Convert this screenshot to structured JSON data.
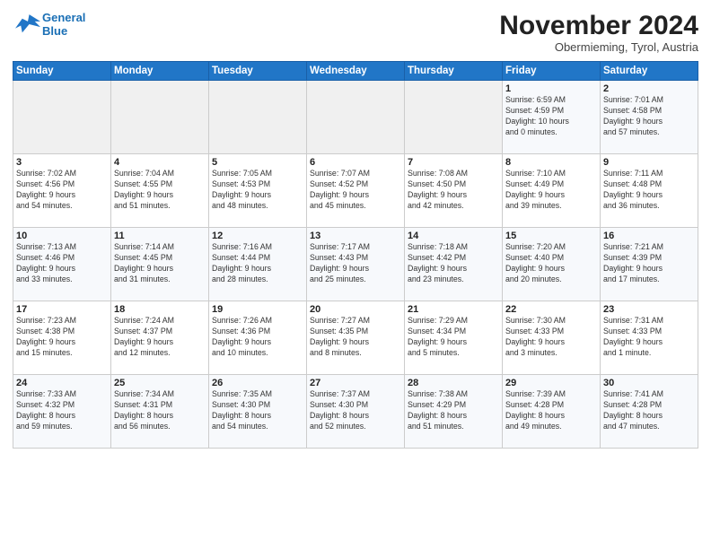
{
  "header": {
    "logo_top": "General",
    "logo_bottom": "Blue",
    "month": "November 2024",
    "location": "Obermieming, Tyrol, Austria"
  },
  "days_of_week": [
    "Sunday",
    "Monday",
    "Tuesday",
    "Wednesday",
    "Thursday",
    "Friday",
    "Saturday"
  ],
  "weeks": [
    [
      {
        "num": "",
        "info": ""
      },
      {
        "num": "",
        "info": ""
      },
      {
        "num": "",
        "info": ""
      },
      {
        "num": "",
        "info": ""
      },
      {
        "num": "",
        "info": ""
      },
      {
        "num": "1",
        "info": "Sunrise: 6:59 AM\nSunset: 4:59 PM\nDaylight: 10 hours\nand 0 minutes."
      },
      {
        "num": "2",
        "info": "Sunrise: 7:01 AM\nSunset: 4:58 PM\nDaylight: 9 hours\nand 57 minutes."
      }
    ],
    [
      {
        "num": "3",
        "info": "Sunrise: 7:02 AM\nSunset: 4:56 PM\nDaylight: 9 hours\nand 54 minutes."
      },
      {
        "num": "4",
        "info": "Sunrise: 7:04 AM\nSunset: 4:55 PM\nDaylight: 9 hours\nand 51 minutes."
      },
      {
        "num": "5",
        "info": "Sunrise: 7:05 AM\nSunset: 4:53 PM\nDaylight: 9 hours\nand 48 minutes."
      },
      {
        "num": "6",
        "info": "Sunrise: 7:07 AM\nSunset: 4:52 PM\nDaylight: 9 hours\nand 45 minutes."
      },
      {
        "num": "7",
        "info": "Sunrise: 7:08 AM\nSunset: 4:50 PM\nDaylight: 9 hours\nand 42 minutes."
      },
      {
        "num": "8",
        "info": "Sunrise: 7:10 AM\nSunset: 4:49 PM\nDaylight: 9 hours\nand 39 minutes."
      },
      {
        "num": "9",
        "info": "Sunrise: 7:11 AM\nSunset: 4:48 PM\nDaylight: 9 hours\nand 36 minutes."
      }
    ],
    [
      {
        "num": "10",
        "info": "Sunrise: 7:13 AM\nSunset: 4:46 PM\nDaylight: 9 hours\nand 33 minutes."
      },
      {
        "num": "11",
        "info": "Sunrise: 7:14 AM\nSunset: 4:45 PM\nDaylight: 9 hours\nand 31 minutes."
      },
      {
        "num": "12",
        "info": "Sunrise: 7:16 AM\nSunset: 4:44 PM\nDaylight: 9 hours\nand 28 minutes."
      },
      {
        "num": "13",
        "info": "Sunrise: 7:17 AM\nSunset: 4:43 PM\nDaylight: 9 hours\nand 25 minutes."
      },
      {
        "num": "14",
        "info": "Sunrise: 7:18 AM\nSunset: 4:42 PM\nDaylight: 9 hours\nand 23 minutes."
      },
      {
        "num": "15",
        "info": "Sunrise: 7:20 AM\nSunset: 4:40 PM\nDaylight: 9 hours\nand 20 minutes."
      },
      {
        "num": "16",
        "info": "Sunrise: 7:21 AM\nSunset: 4:39 PM\nDaylight: 9 hours\nand 17 minutes."
      }
    ],
    [
      {
        "num": "17",
        "info": "Sunrise: 7:23 AM\nSunset: 4:38 PM\nDaylight: 9 hours\nand 15 minutes."
      },
      {
        "num": "18",
        "info": "Sunrise: 7:24 AM\nSunset: 4:37 PM\nDaylight: 9 hours\nand 12 minutes."
      },
      {
        "num": "19",
        "info": "Sunrise: 7:26 AM\nSunset: 4:36 PM\nDaylight: 9 hours\nand 10 minutes."
      },
      {
        "num": "20",
        "info": "Sunrise: 7:27 AM\nSunset: 4:35 PM\nDaylight: 9 hours\nand 8 minutes."
      },
      {
        "num": "21",
        "info": "Sunrise: 7:29 AM\nSunset: 4:34 PM\nDaylight: 9 hours\nand 5 minutes."
      },
      {
        "num": "22",
        "info": "Sunrise: 7:30 AM\nSunset: 4:33 PM\nDaylight: 9 hours\nand 3 minutes."
      },
      {
        "num": "23",
        "info": "Sunrise: 7:31 AM\nSunset: 4:33 PM\nDaylight: 9 hours\nand 1 minute."
      }
    ],
    [
      {
        "num": "24",
        "info": "Sunrise: 7:33 AM\nSunset: 4:32 PM\nDaylight: 8 hours\nand 59 minutes."
      },
      {
        "num": "25",
        "info": "Sunrise: 7:34 AM\nSunset: 4:31 PM\nDaylight: 8 hours\nand 56 minutes."
      },
      {
        "num": "26",
        "info": "Sunrise: 7:35 AM\nSunset: 4:30 PM\nDaylight: 8 hours\nand 54 minutes."
      },
      {
        "num": "27",
        "info": "Sunrise: 7:37 AM\nSunset: 4:30 PM\nDaylight: 8 hours\nand 52 minutes."
      },
      {
        "num": "28",
        "info": "Sunrise: 7:38 AM\nSunset: 4:29 PM\nDaylight: 8 hours\nand 51 minutes."
      },
      {
        "num": "29",
        "info": "Sunrise: 7:39 AM\nSunset: 4:28 PM\nDaylight: 8 hours\nand 49 minutes."
      },
      {
        "num": "30",
        "info": "Sunrise: 7:41 AM\nSunset: 4:28 PM\nDaylight: 8 hours\nand 47 minutes."
      }
    ]
  ]
}
